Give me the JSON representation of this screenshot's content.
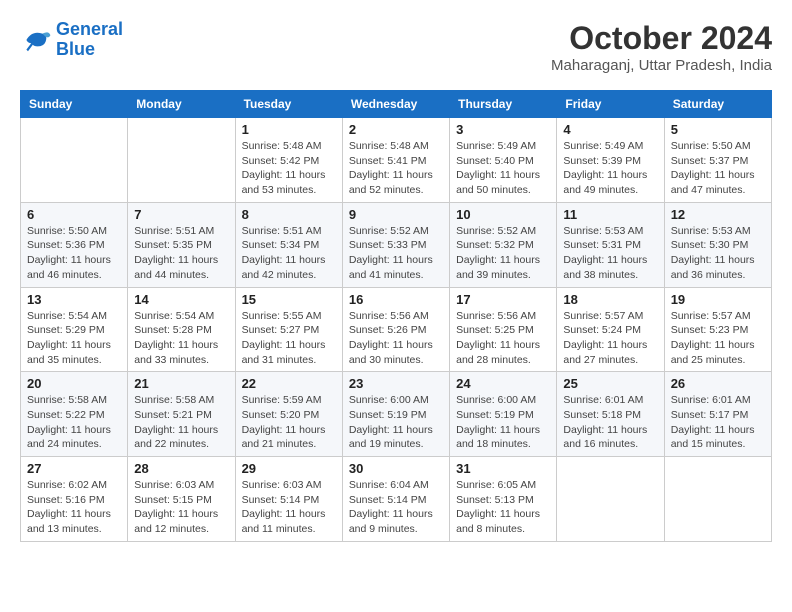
{
  "logo": {
    "line1": "General",
    "line2": "Blue"
  },
  "title": "October 2024",
  "location": "Maharaganj, Uttar Pradesh, India",
  "weekdays": [
    "Sunday",
    "Monday",
    "Tuesday",
    "Wednesday",
    "Thursday",
    "Friday",
    "Saturday"
  ],
  "weeks": [
    [
      {
        "day": "",
        "info": ""
      },
      {
        "day": "",
        "info": ""
      },
      {
        "day": "1",
        "info": "Sunrise: 5:48 AM\nSunset: 5:42 PM\nDaylight: 11 hours and 53 minutes."
      },
      {
        "day": "2",
        "info": "Sunrise: 5:48 AM\nSunset: 5:41 PM\nDaylight: 11 hours and 52 minutes."
      },
      {
        "day": "3",
        "info": "Sunrise: 5:49 AM\nSunset: 5:40 PM\nDaylight: 11 hours and 50 minutes."
      },
      {
        "day": "4",
        "info": "Sunrise: 5:49 AM\nSunset: 5:39 PM\nDaylight: 11 hours and 49 minutes."
      },
      {
        "day": "5",
        "info": "Sunrise: 5:50 AM\nSunset: 5:37 PM\nDaylight: 11 hours and 47 minutes."
      }
    ],
    [
      {
        "day": "6",
        "info": "Sunrise: 5:50 AM\nSunset: 5:36 PM\nDaylight: 11 hours and 46 minutes."
      },
      {
        "day": "7",
        "info": "Sunrise: 5:51 AM\nSunset: 5:35 PM\nDaylight: 11 hours and 44 minutes."
      },
      {
        "day": "8",
        "info": "Sunrise: 5:51 AM\nSunset: 5:34 PM\nDaylight: 11 hours and 42 minutes."
      },
      {
        "day": "9",
        "info": "Sunrise: 5:52 AM\nSunset: 5:33 PM\nDaylight: 11 hours and 41 minutes."
      },
      {
        "day": "10",
        "info": "Sunrise: 5:52 AM\nSunset: 5:32 PM\nDaylight: 11 hours and 39 minutes."
      },
      {
        "day": "11",
        "info": "Sunrise: 5:53 AM\nSunset: 5:31 PM\nDaylight: 11 hours and 38 minutes."
      },
      {
        "day": "12",
        "info": "Sunrise: 5:53 AM\nSunset: 5:30 PM\nDaylight: 11 hours and 36 minutes."
      }
    ],
    [
      {
        "day": "13",
        "info": "Sunrise: 5:54 AM\nSunset: 5:29 PM\nDaylight: 11 hours and 35 minutes."
      },
      {
        "day": "14",
        "info": "Sunrise: 5:54 AM\nSunset: 5:28 PM\nDaylight: 11 hours and 33 minutes."
      },
      {
        "day": "15",
        "info": "Sunrise: 5:55 AM\nSunset: 5:27 PM\nDaylight: 11 hours and 31 minutes."
      },
      {
        "day": "16",
        "info": "Sunrise: 5:56 AM\nSunset: 5:26 PM\nDaylight: 11 hours and 30 minutes."
      },
      {
        "day": "17",
        "info": "Sunrise: 5:56 AM\nSunset: 5:25 PM\nDaylight: 11 hours and 28 minutes."
      },
      {
        "day": "18",
        "info": "Sunrise: 5:57 AM\nSunset: 5:24 PM\nDaylight: 11 hours and 27 minutes."
      },
      {
        "day": "19",
        "info": "Sunrise: 5:57 AM\nSunset: 5:23 PM\nDaylight: 11 hours and 25 minutes."
      }
    ],
    [
      {
        "day": "20",
        "info": "Sunrise: 5:58 AM\nSunset: 5:22 PM\nDaylight: 11 hours and 24 minutes."
      },
      {
        "day": "21",
        "info": "Sunrise: 5:58 AM\nSunset: 5:21 PM\nDaylight: 11 hours and 22 minutes."
      },
      {
        "day": "22",
        "info": "Sunrise: 5:59 AM\nSunset: 5:20 PM\nDaylight: 11 hours and 21 minutes."
      },
      {
        "day": "23",
        "info": "Sunrise: 6:00 AM\nSunset: 5:19 PM\nDaylight: 11 hours and 19 minutes."
      },
      {
        "day": "24",
        "info": "Sunrise: 6:00 AM\nSunset: 5:19 PM\nDaylight: 11 hours and 18 minutes."
      },
      {
        "day": "25",
        "info": "Sunrise: 6:01 AM\nSunset: 5:18 PM\nDaylight: 11 hours and 16 minutes."
      },
      {
        "day": "26",
        "info": "Sunrise: 6:01 AM\nSunset: 5:17 PM\nDaylight: 11 hours and 15 minutes."
      }
    ],
    [
      {
        "day": "27",
        "info": "Sunrise: 6:02 AM\nSunset: 5:16 PM\nDaylight: 11 hours and 13 minutes."
      },
      {
        "day": "28",
        "info": "Sunrise: 6:03 AM\nSunset: 5:15 PM\nDaylight: 11 hours and 12 minutes."
      },
      {
        "day": "29",
        "info": "Sunrise: 6:03 AM\nSunset: 5:14 PM\nDaylight: 11 hours and 11 minutes."
      },
      {
        "day": "30",
        "info": "Sunrise: 6:04 AM\nSunset: 5:14 PM\nDaylight: 11 hours and 9 minutes."
      },
      {
        "day": "31",
        "info": "Sunrise: 6:05 AM\nSunset: 5:13 PM\nDaylight: 11 hours and 8 minutes."
      },
      {
        "day": "",
        "info": ""
      },
      {
        "day": "",
        "info": ""
      }
    ]
  ]
}
